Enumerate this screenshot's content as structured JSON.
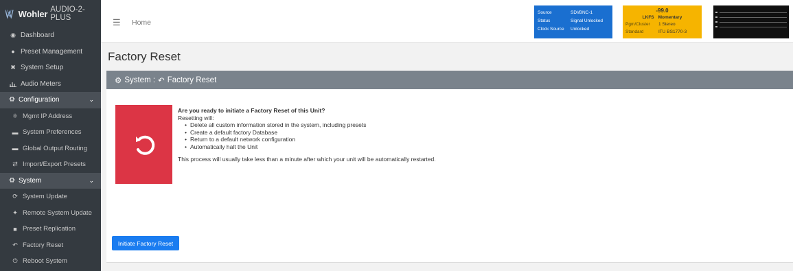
{
  "brand": {
    "logo": "Wohler",
    "product": "AUDIO-2-PLUS"
  },
  "sidebar": {
    "items": [
      {
        "label": "Dashboard",
        "icon": "dashboard-icon"
      },
      {
        "label": "Preset Management",
        "icon": "users-icon"
      },
      {
        "label": "System Setup",
        "icon": "tools-icon"
      },
      {
        "label": "Audio Meters",
        "icon": "chart-icon"
      }
    ],
    "configuration": {
      "label": "Configuration",
      "items": [
        {
          "label": "Mgmt IP Address",
          "icon": "network-icon"
        },
        {
          "label": "System Preferences",
          "icon": "keyboard-icon"
        },
        {
          "label": "Global Output Routing",
          "icon": "keyboard-icon"
        },
        {
          "label": "Import/Export Presets",
          "icon": "exchange-icon"
        }
      ]
    },
    "system": {
      "label": "System",
      "items": [
        {
          "label": "System Update",
          "icon": "sync-icon"
        },
        {
          "label": "Remote System Update",
          "icon": "satellite-icon"
        },
        {
          "label": "Preset Replication",
          "icon": "copy-icon"
        },
        {
          "label": "Factory Reset",
          "icon": "undo-icon"
        },
        {
          "label": "Reboot System",
          "icon": "power-icon"
        }
      ]
    }
  },
  "header": {
    "home": "Home"
  },
  "status_blue": {
    "rows": [
      {
        "k": "Source",
        "v": "SDI/BNC-1"
      },
      {
        "k": "Status",
        "v": "Signal Unlocked"
      },
      {
        "k": "Clock Source",
        "v": "Unlocked"
      }
    ]
  },
  "status_yellow": {
    "peak": "-99.0",
    "mode_key": "LKFS",
    "mode_val": "Momentary",
    "rows": [
      {
        "k": "Pgm/Cluster",
        "v": "1  Stereo"
      },
      {
        "k": "Standard",
        "v": "ITU BS1770-3"
      }
    ]
  },
  "page": {
    "title": "Factory Reset"
  },
  "card": {
    "header_prefix": "System :",
    "header_title": "Factory Reset",
    "question": "Are you ready to initiate a Factory Reset of this Unit?",
    "intro": "Resetting will:",
    "bullets": [
      "Delete all custom information stored in the system, including presets",
      "Create a default factory Database",
      "Return to a default network configuration",
      "Automatically halt the Unit"
    ],
    "note": "This process will usually take less than a minute after which your unit will be automatically restarted.",
    "button": "Initiate Factory Reset"
  },
  "colors": {
    "sidebar": "#343a40",
    "danger": "#dc3545",
    "primary": "#1a7cf0",
    "status_blue": "#1a6fd0",
    "status_yellow": "#f6b400"
  }
}
